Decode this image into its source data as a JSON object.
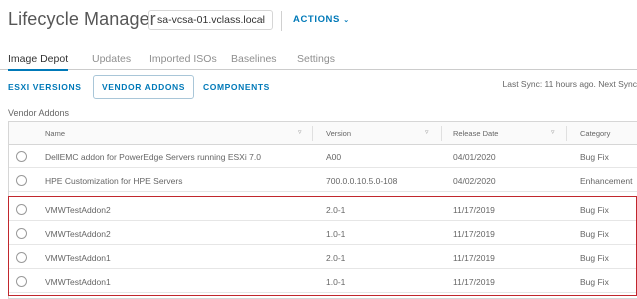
{
  "header": {
    "title": "Lifecycle Manager",
    "server_selected": "sa-vcsa-01.vclass.local",
    "actions_label": "ACTIONS"
  },
  "tabs": [
    {
      "label": "Image Depot",
      "active": true
    },
    {
      "label": "Updates",
      "active": false
    },
    {
      "label": "Imported ISOs",
      "active": false
    },
    {
      "label": "Baselines",
      "active": false
    },
    {
      "label": "Settings",
      "active": false
    }
  ],
  "subtabs": [
    {
      "label": "ESXI VERSIONS",
      "selected": false
    },
    {
      "label": "VENDOR ADDONS",
      "selected": true
    },
    {
      "label": "COMPONENTS",
      "selected": false
    }
  ],
  "last_sync": "Last Sync: 11 hours ago. Next Sync",
  "section_label": "Vendor Addons",
  "table": {
    "columns": [
      "Name",
      "Version",
      "Release Date",
      "Category"
    ],
    "rows": [
      {
        "name": "DellEMC addon for PowerEdge Servers running ESXi 7.0",
        "version": "A00",
        "release_date": "04/01/2020",
        "category": "Bug Fix"
      },
      {
        "name": "HPE Customization for HPE Servers",
        "version": "700.0.0.10.5.0-108",
        "release_date": "04/02/2020",
        "category": "Enhancement"
      },
      {
        "name": "VMWTestAddon2",
        "version": "2.0-1",
        "release_date": "11/17/2019",
        "category": "Bug Fix"
      },
      {
        "name": "VMWTestAddon2",
        "version": "1.0-1",
        "release_date": "11/17/2019",
        "category": "Bug Fix"
      },
      {
        "name": "VMWTestAddon1",
        "version": "2.0-1",
        "release_date": "11/17/2019",
        "category": "Bug Fix"
      },
      {
        "name": "VMWTestAddon1",
        "version": "1.0-1",
        "release_date": "11/17/2019",
        "category": "Bug Fix"
      }
    ]
  },
  "colors": {
    "accent": "#0079b8",
    "highlight": "#c1272d"
  }
}
